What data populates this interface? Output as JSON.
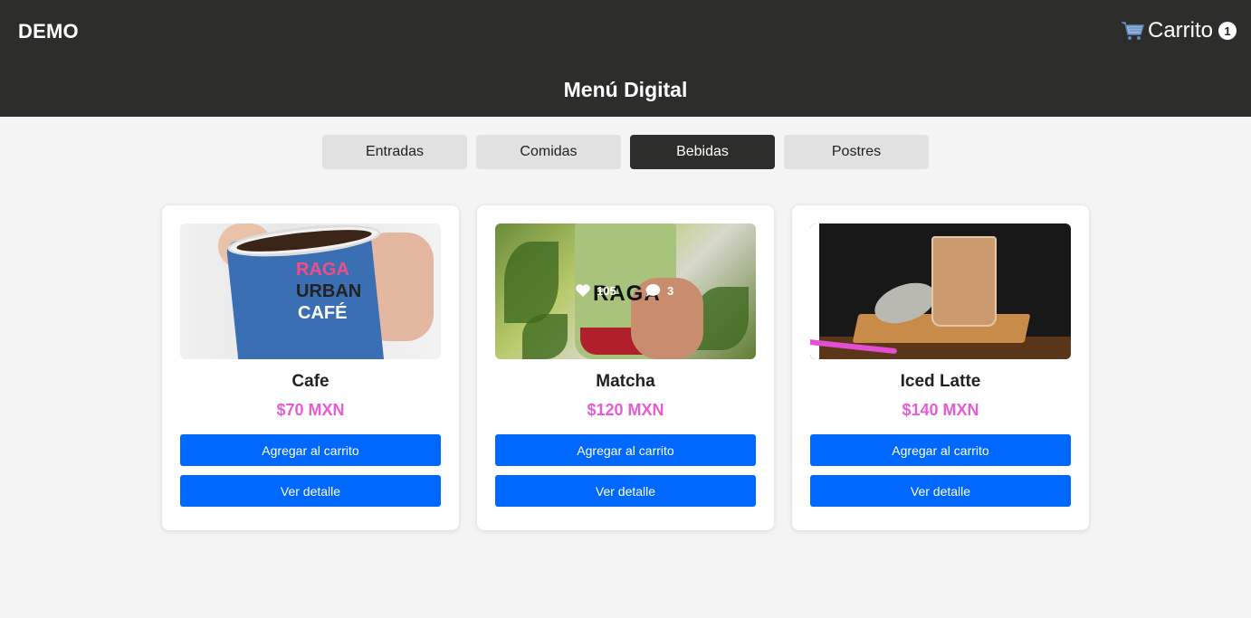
{
  "header": {
    "brand": "DEMO",
    "cart_label": "Carrito",
    "cart_count": "1",
    "cart_icon": "cart-icon",
    "subtitle": "Menú Digital"
  },
  "tabs": [
    {
      "label": "Entradas",
      "active": false
    },
    {
      "label": "Comidas",
      "active": false
    },
    {
      "label": "Bebidas",
      "active": true
    },
    {
      "label": "Postres",
      "active": false
    }
  ],
  "products": [
    {
      "name": "Cafe",
      "price": "$70 MXN",
      "add_label": "Agregar al carrito",
      "detail_label": "Ver detalle",
      "image_text": {
        "brand": "RAGA",
        "words": [
          "URBAN",
          "CAFÉ"
        ]
      }
    },
    {
      "name": "Matcha",
      "price": "$120 MXN",
      "add_label": "Agregar al carrito",
      "detail_label": "Ver detalle",
      "image_text": {
        "logo": "RAGA",
        "likes": "105",
        "comments": "3"
      }
    },
    {
      "name": "Iced Latte",
      "price": "$140 MXN",
      "add_label": "Agregar al carrito",
      "detail_label": "Ver detalle"
    }
  ],
  "colors": {
    "header_bg": "#2d2d2b",
    "price": "#e85bd6",
    "button": "#0068ff",
    "tab_inactive": "#e1e1e1"
  }
}
